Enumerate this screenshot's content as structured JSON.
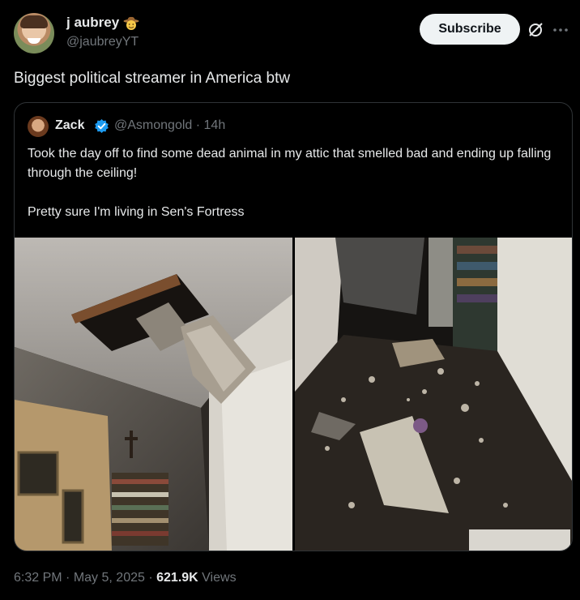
{
  "author": {
    "display_name": "j aubrey",
    "handle": "@jaubreyYT",
    "badge_icon": "cowboy-emoji"
  },
  "actions": {
    "subscribe_label": "Subscribe",
    "grok_icon": "grok-icon",
    "more_icon": "more-icon"
  },
  "post_text": "Biggest political streamer in America btw",
  "quote": {
    "display_name": "Zack",
    "verified": true,
    "handle": "@Asmongold",
    "separator": "·",
    "time": "14h",
    "paragraphs": [
      "Took the day off to find some dead animal in my attic that smelled bad and ending up falling through the ceiling!",
      "Pretty sure I'm living in Sen's Fortress"
    ],
    "media": [
      {
        "kind": "photo",
        "subject": "hole-in-ceiling"
      },
      {
        "kind": "photo",
        "subject": "debris-on-floor"
      }
    ]
  },
  "meta": {
    "time": "6:32 PM",
    "sep1": "·",
    "date": "May 5, 2025",
    "sep2": "·",
    "views": "621.9K",
    "views_label": "Views"
  },
  "colors": {
    "background": "#000000",
    "text_primary": "#e7e9ea",
    "text_secondary": "#71767b",
    "border": "#2f3336",
    "verified_blue": "#1d9bf0",
    "button_bg": "#eff3f4"
  }
}
